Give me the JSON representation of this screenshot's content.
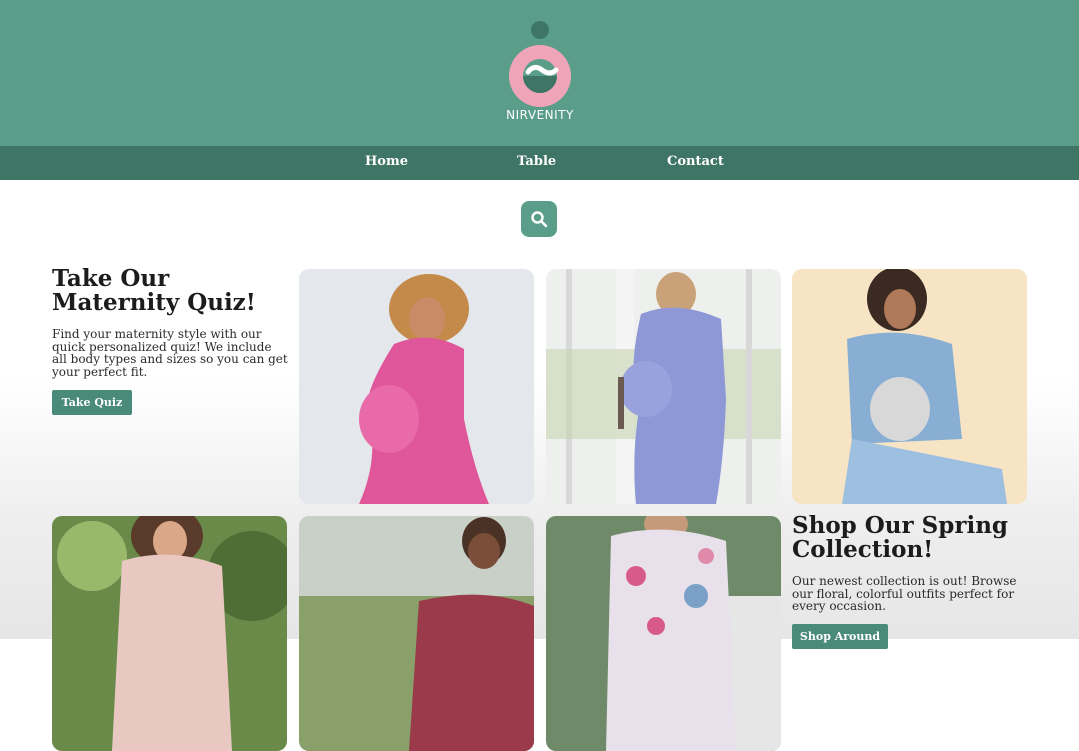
{
  "brand": {
    "name": "NIRVENITY",
    "color": "#5a9e8a",
    "accent": "#f0a4b8"
  },
  "nav": {
    "items": [
      "Home",
      "Table",
      "Contact"
    ]
  },
  "search": {
    "icon": "search-icon"
  },
  "quiz": {
    "title": "Take Our Maternity Quiz!",
    "text": "Find your maternity style with our quick personalized quiz! We include all body types and sizes so you can get your perfect fit.",
    "button_label": "Take Quiz"
  },
  "spring": {
    "title": "Shop Our Spring Collection!",
    "text": "Our newest collection is out! Browse our floral, colorful outfits perfect for every occasion.",
    "button_label": "Shop Around"
  },
  "colors": {
    "nav_bg": "#3f7565",
    "button": "#4a8a78"
  }
}
